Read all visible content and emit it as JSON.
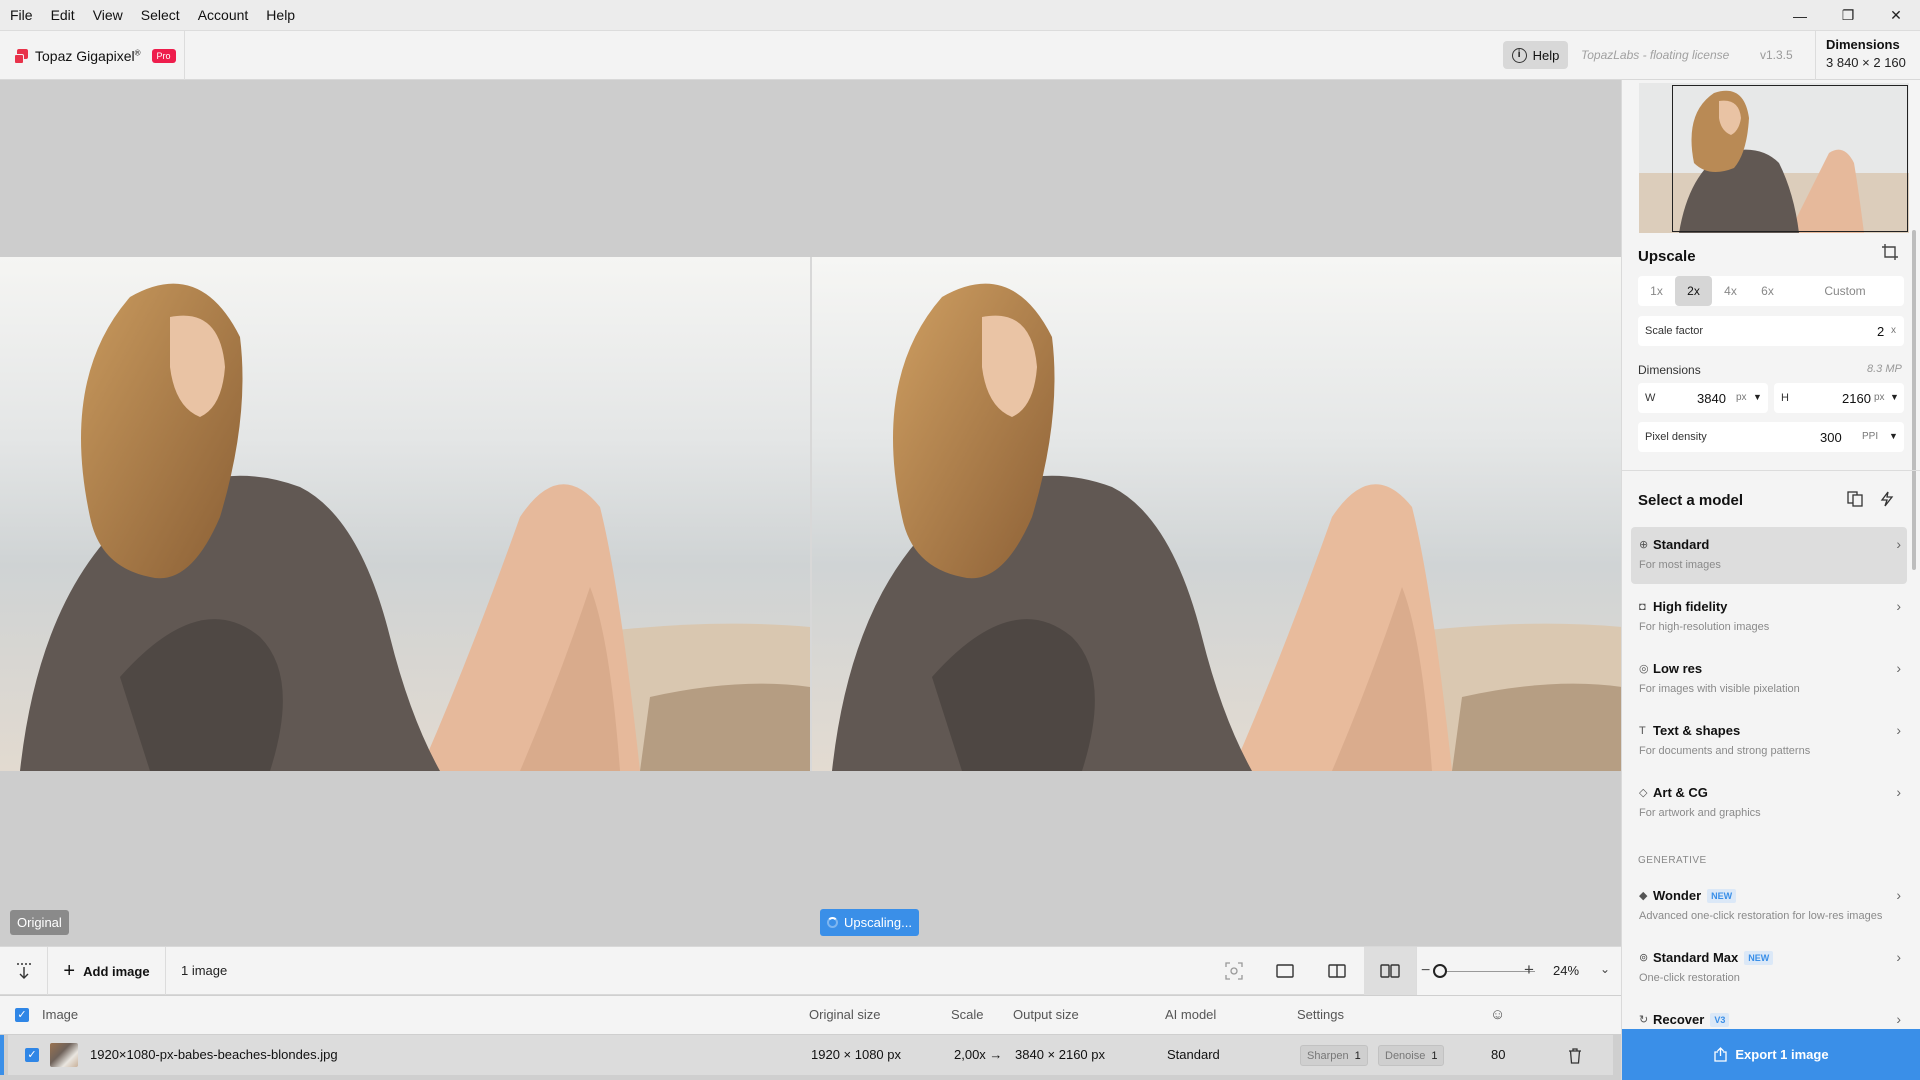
{
  "menu": [
    "File",
    "Edit",
    "View",
    "Select",
    "Account",
    "Help"
  ],
  "window_controls": {
    "minimize": "—",
    "restore": "❐",
    "close": "✕"
  },
  "app": {
    "name": "Topaz Gigapixel",
    "trademark": "®",
    "badge": "Pro"
  },
  "header": {
    "help_label": "Help",
    "license": "TopazLabs - floating license",
    "version": "v1.3.5",
    "dimensions_title": "Dimensions",
    "dimensions_value": "3 840 × 2 160"
  },
  "canvas": {
    "original_label": "Original",
    "status_label": "Upscaling..."
  },
  "toolbar": {
    "add_image_label": "Add image",
    "image_count": "1 image",
    "zoom_value": "24%",
    "zoom_level_fraction": 0.24
  },
  "table": {
    "headers": {
      "image": "Image",
      "original_size": "Original size",
      "scale": "Scale",
      "output_size": "Output size",
      "ai_model": "AI model",
      "settings": "Settings"
    },
    "row": {
      "filename": "1920×1080-px-babes-beaches-blondes.jpg",
      "original_size": "1920 × 1080 px",
      "scale": "2,00x →",
      "output_size": "3840 × 2160 px",
      "ai_model": "Standard",
      "sharpen_label": "Sharpen",
      "sharpen_value": "1",
      "denoise_label": "Denoise",
      "denoise_value": "1",
      "quality": "80"
    }
  },
  "panel": {
    "upscale_title": "Upscale",
    "scale_options": [
      "1x",
      "2x",
      "4x",
      "6x",
      "Custom"
    ],
    "scale_selected": "2x",
    "scale_factor_label": "Scale factor",
    "scale_factor_value": "2",
    "scale_factor_unit": "x",
    "dimensions_label": "Dimensions",
    "megapixels": "8.3 MP",
    "width_label": "W",
    "width_value": "3840",
    "height_label": "H",
    "height_value": "2160",
    "px_unit": "px",
    "pixel_density_label": "Pixel density",
    "pixel_density_value": "300",
    "ppi_unit": "PPI",
    "select_model_title": "Select a model",
    "generative_label": "GENERATIVE",
    "models": [
      {
        "name": "Standard",
        "desc": "For most images",
        "icon": "standard-icon"
      },
      {
        "name": "High fidelity",
        "desc": "For high-resolution images",
        "icon": "camera-icon"
      },
      {
        "name": "Low res",
        "desc": "For images with visible pixelation",
        "icon": "lowres-icon"
      },
      {
        "name": "Text & shapes",
        "desc": "For documents and strong patterns",
        "icon": "text-icon"
      },
      {
        "name": "Art & CG",
        "desc": "For artwork and graphics",
        "icon": "tag-icon"
      }
    ],
    "generative_models": [
      {
        "name": "Wonder",
        "badge": "NEW",
        "desc": "Advanced one-click restoration for low-res images",
        "icon": "gem-icon"
      },
      {
        "name": "Standard Max",
        "badge": "NEW",
        "desc": "One-click restoration",
        "icon": "max-icon"
      },
      {
        "name": "Recover",
        "badge": "V3",
        "desc": "",
        "icon": "recover-icon"
      }
    ],
    "export_label": "Export 1 image"
  },
  "colors": {
    "accent": "#3a8fe8",
    "brand": "#e8324a",
    "pro_badge": "#ee1d4c"
  }
}
